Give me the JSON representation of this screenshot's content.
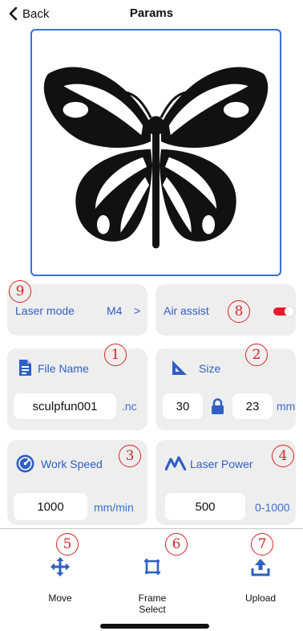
{
  "header": {
    "back_label": "Back",
    "title": "Params"
  },
  "laser_mode": {
    "label": "Laser mode",
    "value": "M4",
    "chevron": ">",
    "marker": "9"
  },
  "air_assist": {
    "label": "Air assist",
    "enabled": true,
    "marker": "8"
  },
  "file_name": {
    "label": "File Name",
    "value": "sculpfun001",
    "ext": ".nc",
    "marker": "1"
  },
  "size": {
    "label": "Size",
    "width": "30",
    "height": "23",
    "unit": "mm",
    "marker": "2"
  },
  "work_speed": {
    "label": "Work Speed",
    "value": "1000",
    "unit": "mm/min",
    "marker": "3"
  },
  "laser_power": {
    "label": "Laser Power",
    "value": "500",
    "range": "0-1000",
    "marker": "4"
  },
  "toolbar": {
    "move": {
      "label": "Move",
      "marker": "5"
    },
    "frame": {
      "label_line1": "Frame",
      "label_line2": "Select",
      "marker": "6"
    },
    "upload": {
      "label": "Upload",
      "marker": "7"
    }
  },
  "colors": {
    "accent": "#2f5fc4",
    "annotation": "#d62626",
    "card_bg": "#eeeeee",
    "toggle_on": "#e8192c"
  }
}
